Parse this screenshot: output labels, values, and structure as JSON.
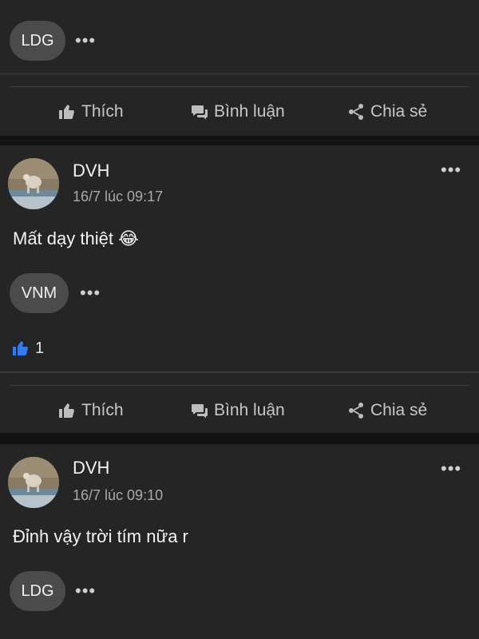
{
  "actions": {
    "like_label": "Thích",
    "comment_label": "Bình luận",
    "share_label": "Chia sẻ"
  },
  "icons": {
    "more": "more-horizontal-icon",
    "like": "thumbs-up-icon",
    "comment": "speech-bubbles-icon",
    "share": "share-icon"
  },
  "top_post": {
    "reaction_user": "LDG",
    "more": "•••"
  },
  "posts": [
    {
      "author": "DVH",
      "timestamp": "16/7 lúc 09:17",
      "text": "Mất dạy thiệt",
      "emoji": "😂",
      "reaction_user": "VNM",
      "more": "•••",
      "like_count": "1"
    },
    {
      "author": "DVH",
      "timestamp": "16/7 lúc 09:10",
      "text": "Đỉnh vậy trời tím nữa r",
      "reaction_user": "LDG",
      "more": "•••"
    }
  ],
  "colors": {
    "background": "#121212",
    "card": "#252525",
    "pill": "#4b4b4b",
    "like_blue": "#2f7cf6"
  }
}
